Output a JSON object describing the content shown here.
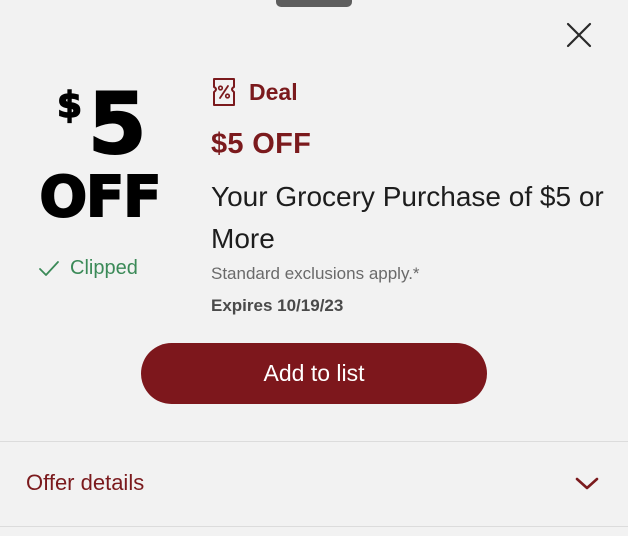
{
  "sheet": {
    "close_icon": "close-icon"
  },
  "badge": {
    "currency": "$",
    "amount": "5",
    "off_text": "OFF",
    "status_icon": "checkmark-icon",
    "status_label": "Clipped",
    "status_color": "#3b8a58"
  },
  "offer": {
    "type_icon": "coupon-icon",
    "type_label": "Deal",
    "title": "$5 OFF",
    "description": "Your Grocery Purchase of $5 or More",
    "exclusions": "Standard exclusions apply.*",
    "expires": "Expires 10/19/23",
    "accent_color": "#7b1a1d"
  },
  "actions": {
    "add_to_list_label": "Add to list",
    "button_color": "#7d171c"
  },
  "details": {
    "label": "Offer details",
    "chevron_icon": "chevron-down-icon"
  }
}
